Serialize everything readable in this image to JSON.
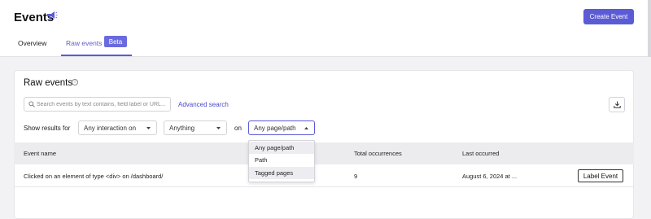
{
  "header": {
    "title": "Events",
    "create_button": "Create Event",
    "tabs": [
      {
        "label": "Overview"
      },
      {
        "label": "Raw events",
        "badge": "Beta",
        "active": true
      }
    ]
  },
  "panel": {
    "title": "Raw events",
    "search_placeholder": "Search events by text contains, field label or URL...",
    "advanced_search": "Advanced search",
    "show_results_label": "Show results for",
    "filter_interaction": "Any interaction on",
    "filter_target": "Anything",
    "on_label": "on",
    "filter_page": "Any page/path",
    "page_options": [
      "Any page/path",
      "Path",
      "Tagged pages"
    ]
  },
  "table": {
    "columns": [
      "Event name",
      "Total occurrences",
      "Last occurred"
    ],
    "rows": [
      {
        "name": "Clicked on an element of type <div> on /dashboard/",
        "total": "9",
        "last": "August 6, 2024 at ...",
        "action": "Label Event"
      }
    ]
  },
  "colors": {
    "accent": "#5b5bd6",
    "badge": "#6a6ae0"
  }
}
